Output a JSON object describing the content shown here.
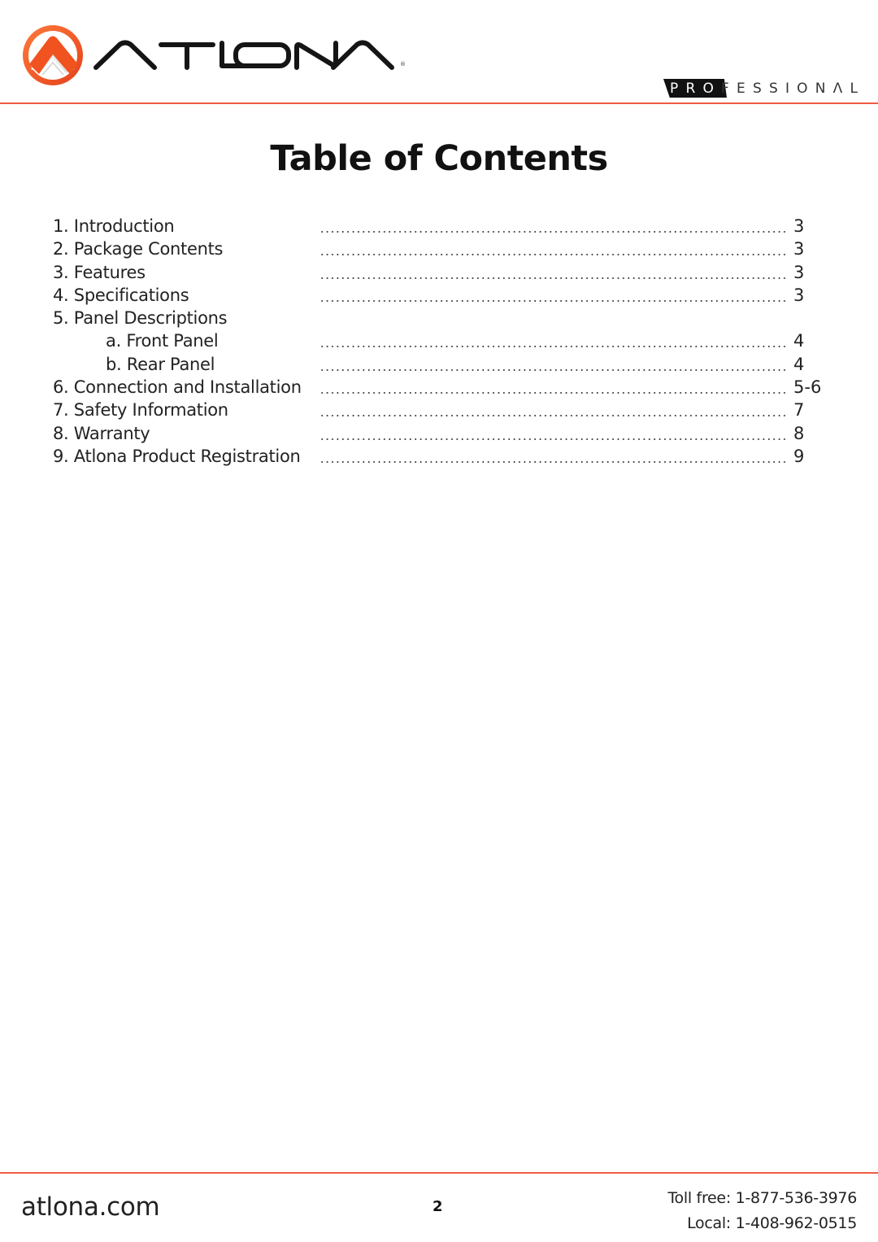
{
  "header": {
    "brand_name": "ATLONA",
    "brand_registered_mark": "®",
    "badge_highlight": "PRO",
    "badge_rest": "FESSIONΛL",
    "accent_color": "#f15a42"
  },
  "title": "Table of Contents",
  "toc": [
    {
      "label": "1. Introduction",
      "page": "3",
      "sub": false,
      "has_leader": true
    },
    {
      "label": "2. Package Contents",
      "page": "3",
      "sub": false,
      "has_leader": true
    },
    {
      "label": "3. Features",
      "page": "3",
      "sub": false,
      "has_leader": true
    },
    {
      "label": "4. Specifications",
      "page": "3",
      "sub": false,
      "has_leader": true
    },
    {
      "label": "5. Panel Descriptions",
      "page": "",
      "sub": false,
      "has_leader": false
    },
    {
      "label": "a. Front Panel",
      "page": "4",
      "sub": true,
      "has_leader": true
    },
    {
      "label": "b. Rear Panel",
      "page": "4",
      "sub": true,
      "has_leader": true
    },
    {
      "label": "6. Connection and Installation",
      "page": "5-6",
      "sub": false,
      "has_leader": true
    },
    {
      "label": "7. Safety Information",
      "page": "7",
      "sub": false,
      "has_leader": true
    },
    {
      "label": "8. Warranty",
      "page": "8",
      "sub": false,
      "has_leader": true
    },
    {
      "label": "9. Atlona Product Registration",
      "page": "9",
      "sub": false,
      "has_leader": true
    }
  ],
  "footer": {
    "website": "atlona.com",
    "page_number": "2",
    "toll_free": "Toll free: 1-877-536-3976",
    "local": "Local: 1-408-962-0515"
  }
}
